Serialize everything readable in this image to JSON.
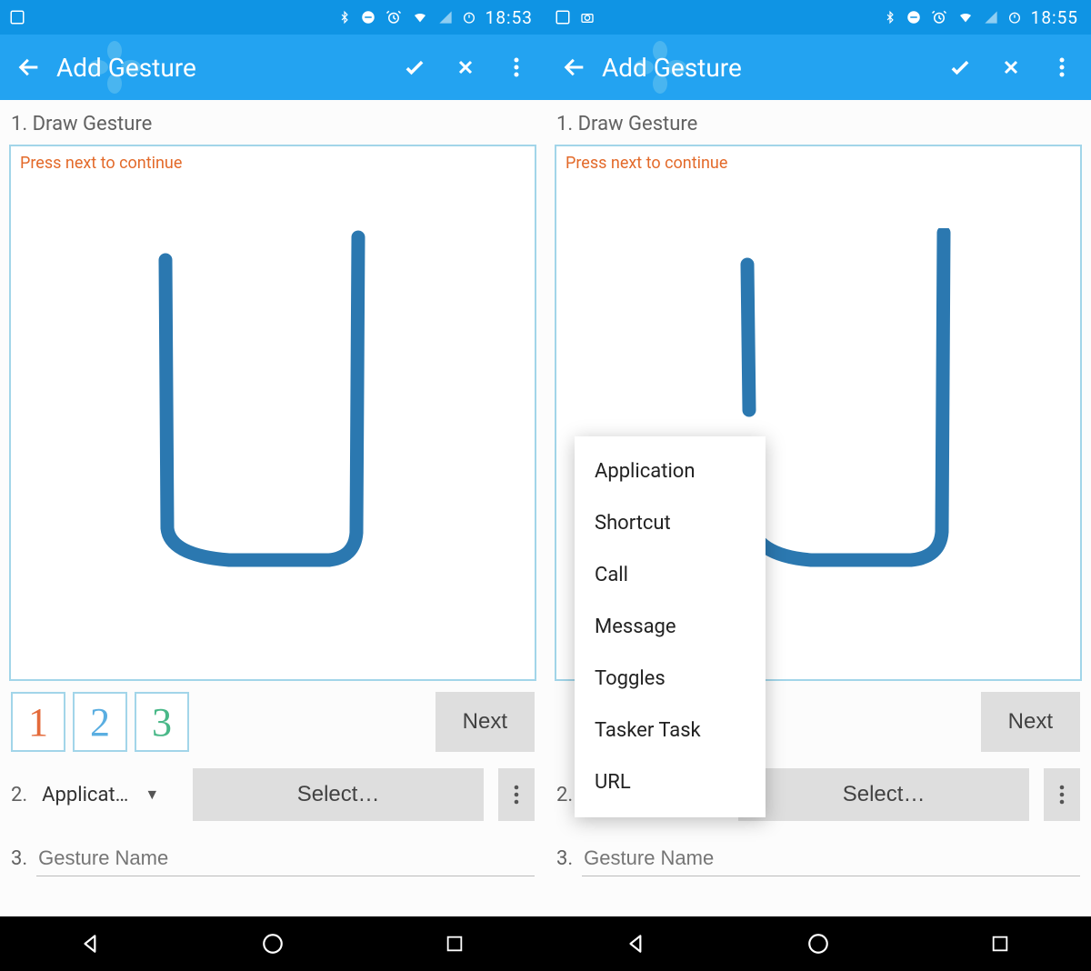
{
  "status": {
    "time_left": "18:53",
    "time_right": "18:55"
  },
  "appbar": {
    "title": "Add Gesture"
  },
  "steps": {
    "s1": "1. Draw Gesture",
    "s2_num": "2.",
    "s2_dropdown": "Applicat…",
    "s3": "3.",
    "s3_placeholder": "Gesture Name"
  },
  "hint": "Press next to continue",
  "counters": {
    "c1": "1",
    "c2": "2",
    "c3": "3"
  },
  "buttons": {
    "next": "Next",
    "select": "Select…"
  },
  "menu": {
    "items": [
      "Application",
      "Shortcut",
      "Call",
      "Message",
      "Toggles",
      "Tasker Task",
      "URL"
    ]
  }
}
